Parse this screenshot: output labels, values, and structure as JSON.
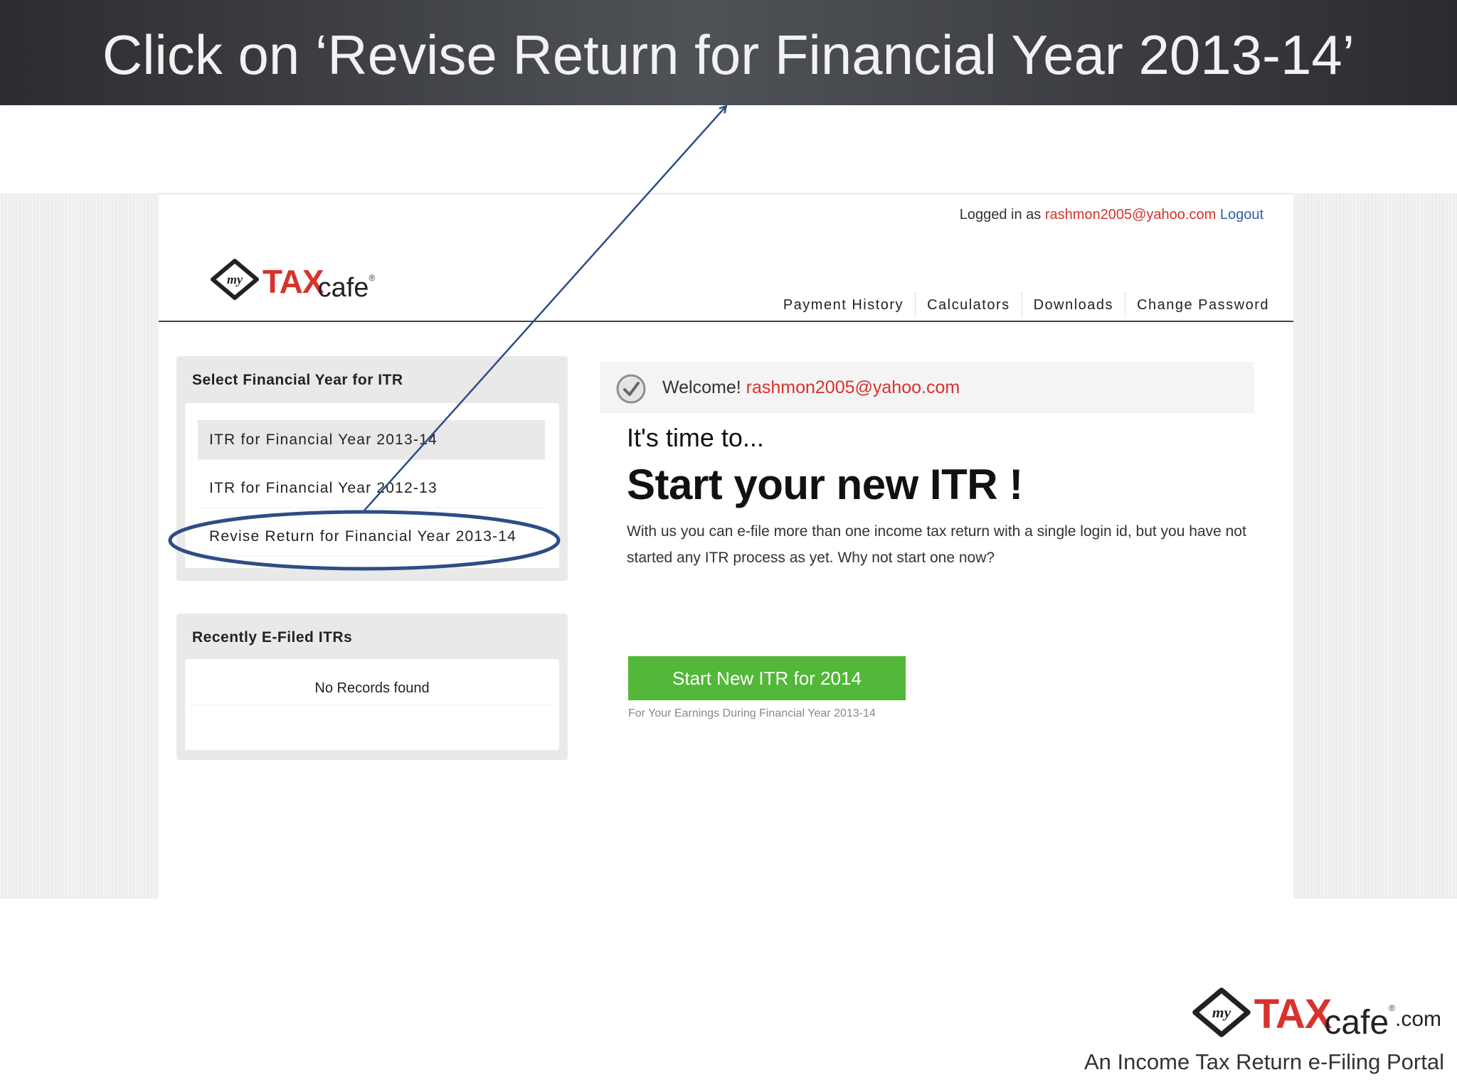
{
  "slide": {
    "title": "Click on ‘Revise Return for Financial Year 2013-14’"
  },
  "header": {
    "logged_in_prefix": "Logged in as",
    "user_email": "rashmon2005@yahoo.com",
    "logout_label": "Logout",
    "logo": {
      "my": "my",
      "tax": "TAX",
      "cafe": "cafe"
    },
    "nav": [
      "Payment History",
      "Calculators",
      "Downloads",
      "Change Password"
    ]
  },
  "sidebar": {
    "fy_panel": {
      "title": "Select Financial Year for ITR",
      "items": [
        "ITR for Financial Year 2013-14",
        "ITR for Financial Year 2012-13",
        "Revise Return for Financial Year 2013-14"
      ]
    },
    "recent_panel": {
      "title": "Recently E-Filed ITRs",
      "empty_text": "No Records found"
    }
  },
  "main": {
    "welcome_prefix": "Welcome!",
    "welcome_email": "rashmon2005@yahoo.com",
    "time_to": "It's time to...",
    "headline": "Start your new ITR !",
    "description": "With us you can e-file more than one income tax return with a single login id, but you have not started any ITR process as yet. Why not start one now?",
    "start_button": "Start  New ITR for 2014",
    "start_subtext": "For Your Earnings During Financial Year 2013-14"
  },
  "footer": {
    "logo": {
      "tax": "TAX",
      "cafe": "cafe",
      "dotcom": ".com"
    },
    "tagline": "An Income Tax Return e-Filing Portal"
  },
  "colors": {
    "brand_red": "#d8322c",
    "button_green": "#53b73a",
    "link_blue": "#2f5fa8",
    "annotation_blue": "#2e4d86"
  }
}
